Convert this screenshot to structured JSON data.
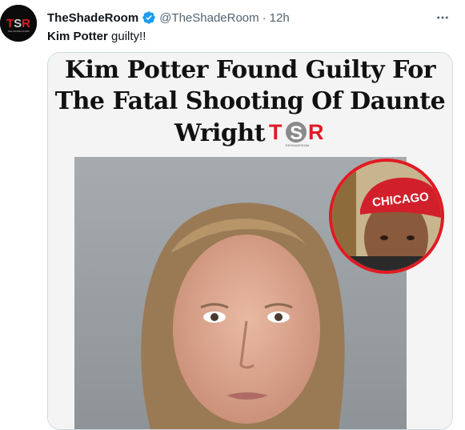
{
  "tweet": {
    "display_name": "TheShadeRoom",
    "handle": "@TheShadeRoom",
    "separator": "·",
    "timestamp": "12h",
    "text_bold": "Kim Potter",
    "text_rest": " guilty!!",
    "verified": true
  },
  "media": {
    "headline_line1": "Kim Potter Found Guilty For",
    "headline_line2": "The Fatal Shooting Of Daunte",
    "headline_line3": "Wright",
    "inset_cap_text": "CHICAGO",
    "brand_logo_text": "TSR",
    "brand_tagline": "THE SHADE ROOM"
  },
  "icons": {
    "avatar": "tsr-logo-avatar",
    "verified": "verified-badge-icon",
    "more": "more-options-icon"
  },
  "colors": {
    "verified_blue": "#1d9bf0",
    "secondary_text": "#536471",
    "brand_red": "#e11a22"
  }
}
